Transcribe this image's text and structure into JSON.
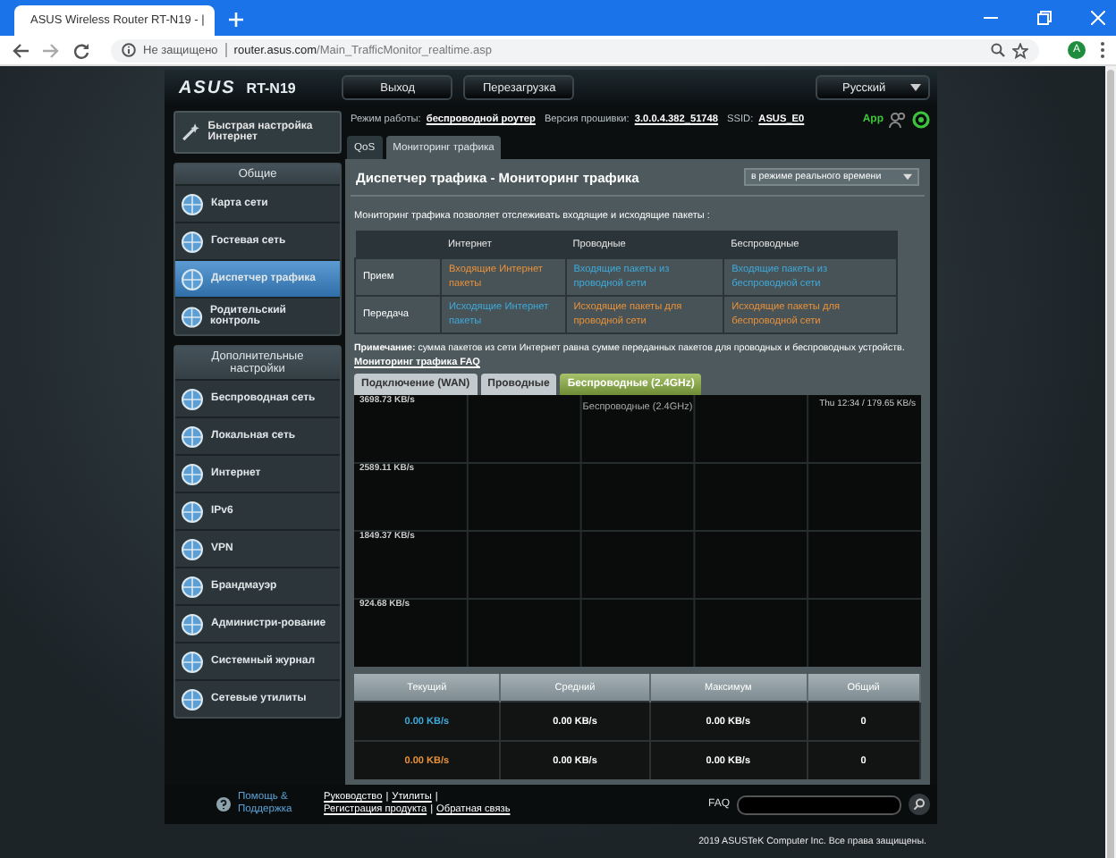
{
  "browser": {
    "tab_title": "ASUS Wireless Router RT-N19 - |",
    "security": "Не защищено",
    "url_host": "router.asus.com",
    "url_path": "/Main_TrafficMonitor_realtime.asp",
    "profile_initial": "A"
  },
  "header": {
    "logo": "ASUS",
    "model": "RT-N19",
    "buttons": [
      "Выход",
      "Перезагрузка"
    ],
    "language": "Русский"
  },
  "quick_setup": "Быстрая настройка Интернет",
  "sidebar": [
    {
      "title": "Общие",
      "items": [
        {
          "label": "Карта сети",
          "selected": false
        },
        {
          "label": "Гостевая сеть",
          "selected": false
        },
        {
          "label": "Диспетчер трафика",
          "selected": true
        },
        {
          "label": "Родительский контроль",
          "selected": false
        }
      ]
    },
    {
      "title": "Дополнительные настройки",
      "items": [
        {
          "label": "Беспроводная сеть",
          "selected": false
        },
        {
          "label": "Локальная сеть",
          "selected": false
        },
        {
          "label": "Интернет",
          "selected": false
        },
        {
          "label": "IPv6",
          "selected": false
        },
        {
          "label": "VPN",
          "selected": false
        },
        {
          "label": "Брандмауэр",
          "selected": false
        },
        {
          "label": "Администри-рование",
          "selected": false
        },
        {
          "label": "Системный журнал",
          "selected": false
        },
        {
          "label": "Сетевые утилиты",
          "selected": false
        }
      ]
    }
  ],
  "status": [
    {
      "label": "Режим работы:",
      "value": "беспроводной роутер"
    },
    {
      "label": "Версия прошивки:",
      "value": "3.0.0.4.382_51748"
    },
    {
      "label": "SSID:",
      "value": "ASUS_E0"
    }
  ],
  "app_label": "App",
  "tabs": [
    {
      "label": "QoS",
      "selected": false
    },
    {
      "label": "Мониторинг трафика",
      "selected": true
    }
  ],
  "panel": {
    "title": "Диспетчер трафика - Мониторинг трафика",
    "mode": "в режиме реального времени",
    "description": "Мониторинг трафика позволяет отслеживать входящие и исходящие пакеты :",
    "table": {
      "columns": [
        "Интернет",
        "Проводные",
        "Беспроводные"
      ],
      "rows": [
        {
          "label": "Прием",
          "cells": [
            {
              "text": "Входящие Интернет пакеты",
              "color": "#e8913a"
            },
            {
              "text": "Входящие пакеты из проводной сети",
              "color": "#3fa9d9"
            },
            {
              "text": "Входящие пакеты из беспроводной сети",
              "color": "#3fa9d9"
            }
          ]
        },
        {
          "label": "Передача",
          "cells": [
            {
              "text": "Исходящие Интернет пакеты",
              "color": "#3fa9d9"
            },
            {
              "text": "Исходящие пакеты для проводной сети",
              "color": "#e8913a"
            },
            {
              "text": "Исходящие пакеты для беспроводной сети",
              "color": "#e8913a"
            }
          ]
        }
      ]
    },
    "note": "**Примечание:** сумма пакетов из сети Интернет равна сумме переданных пакетов для проводных и беспроводных устройств.",
    "faq_link": "Мониторинг трафика FAQ",
    "chart_tabs": [
      {
        "label": "Подключение (WAN)",
        "selected": false
      },
      {
        "label": "Проводные",
        "selected": false
      },
      {
        "label": "Беспроводные (2.4GHz)",
        "selected": true
      }
    ],
    "chart": {
      "y_labels": [
        "3698.73 KB/s",
        "2589.11 KB/s",
        "1849.37 KB/s",
        "924.68 KB/s"
      ],
      "title": "Беспроводные (2.4GHz)",
      "status": "Thu 12:34 / 179.65 KB/s"
    },
    "stats": {
      "columns": [
        "Текущий",
        "Средний",
        "Максимум",
        "Общий"
      ],
      "rows": [
        {
          "color": "#3fa9d9",
          "values": [
            "0.00 KB/s",
            "0.00 KB/s",
            "0.00 KB/s",
            "0"
          ]
        },
        {
          "color": "#e8913a",
          "values": [
            "0.00 KB/s",
            "0.00 KB/s",
            "0.00 KB/s",
            "0"
          ]
        }
      ]
    }
  },
  "footer": {
    "help": "Помощь & Поддержка",
    "links": [
      "Руководство",
      "Утилиты",
      "Регистрация продукта",
      "Обратная связь"
    ],
    "separator": "|",
    "faq_label": "FAQ"
  },
  "copyright": "2019 ASUSTeK Computer Inc. Все права защищены."
}
